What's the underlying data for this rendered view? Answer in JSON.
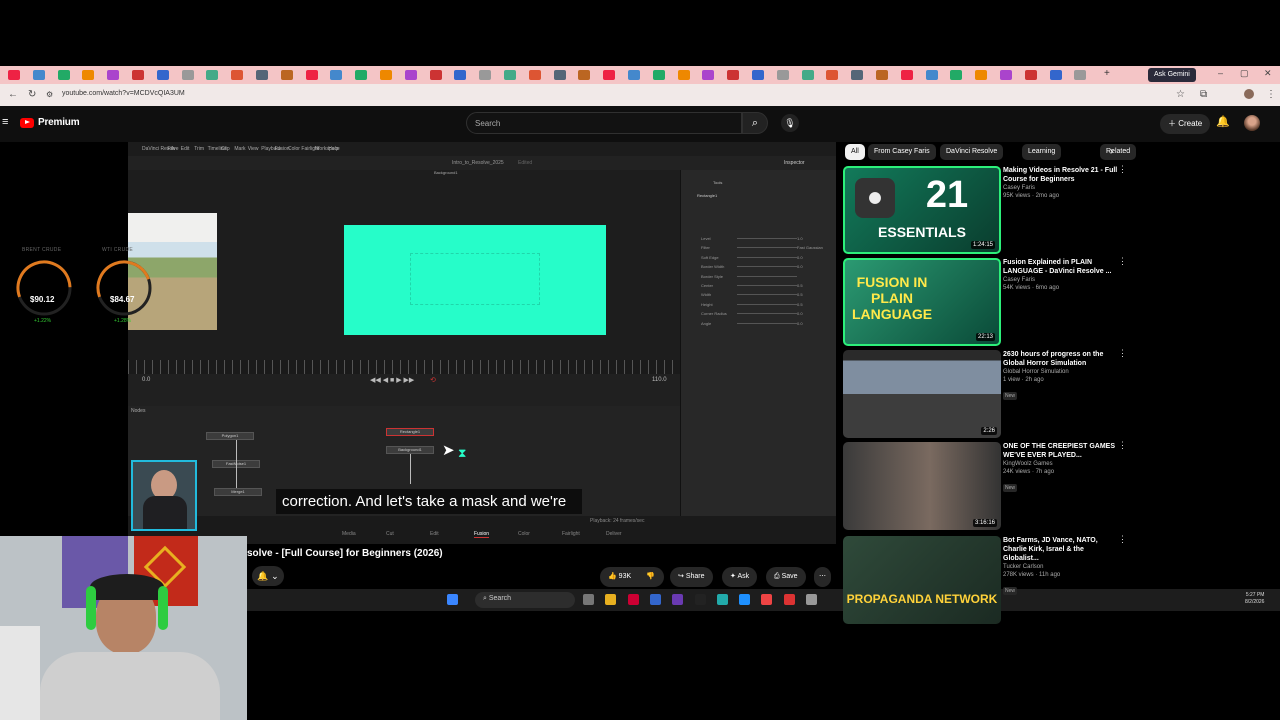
{
  "browser": {
    "url": "youtube.com/watch?v=MCDVcQIA3UM",
    "ask_gemini": "Ask Gemini",
    "tab_count_label": "+"
  },
  "youtube": {
    "brand": "Premium",
    "search_placeholder": "Search",
    "create_label": "Create"
  },
  "video": {
    "caption": "correction. And let's take a mask and we're",
    "title": "solve - [Full Course] for Beginners (2026)",
    "likes": "93K",
    "share_label": "Share",
    "ask_label": "Ask",
    "save_label": "Save",
    "resolve": {
      "menu": [
        "DaVinci Resolve",
        "File",
        "Edit",
        "Trim",
        "Timeline",
        "Clip",
        "Mark",
        "View",
        "Playback",
        "Fusion",
        "Color",
        "Fairlight",
        "Workspace",
        "Help"
      ],
      "project_name": "Intro_to_Resolve_2025",
      "edited": "Edited",
      "viewer_label": "Background1",
      "frame_start": "0.0",
      "frame_end": "110.0",
      "nodes_label": "Nodes",
      "inspector_label": "Inspector",
      "tools_label": "Tools",
      "node_rect": "Rectangle1",
      "nodes": [
        "Polygon1",
        "FastNoise1",
        "Merge1",
        "Rectangle1",
        "Background1"
      ],
      "inspector_rows": [
        "Level",
        "Filter",
        "Soft Edge",
        "Border Width",
        "Border Style",
        "Center",
        "Width",
        "Height",
        "Corner Radius",
        "Angle"
      ],
      "inspector_values": [
        "1.0",
        "Fast Gaussian",
        "0.0",
        "0.0",
        "",
        "0.5",
        "0.5",
        "0.5",
        "0.0",
        "0.0"
      ],
      "pages": [
        "Media",
        "Cut",
        "Edit",
        "Fusion",
        "Color",
        "Fairlight",
        "Deliver"
      ],
      "active_page": "Fusion",
      "playback": "Playback: 24 frames/sec"
    }
  },
  "widgets": {
    "gauges": [
      {
        "label": "BRENT CRUDE",
        "value": "$90.12",
        "change": "+1.22%",
        "level": 0.55
      },
      {
        "label": "WTI CRUDE",
        "value": "$84.67",
        "change": "+1.28%",
        "level": 0.5
      }
    ]
  },
  "sidebar": {
    "chips": [
      "All",
      "From Casey Faris",
      "DaVinci Resolve",
      "Learning",
      "Related"
    ],
    "videos": [
      {
        "title": "Making Videos in Resolve 21 - Full Course for Beginners",
        "channel": "Casey Faris",
        "meta": "95K views · 2mo ago",
        "duration": "1:24:15",
        "thumb_text": "21",
        "thumb_sub": "ESSENTIALS",
        "badge": ""
      },
      {
        "title": "Fusion Explained in PLAIN LANGUAGE - DaVinci Resolve ...",
        "channel": "Casey Faris",
        "meta": "54K views · 6mo ago",
        "duration": "22:13",
        "thumb_text": "FUSION IN PLAIN LANGUAGE",
        "thumb_sub": "",
        "badge": ""
      },
      {
        "title": "2630 hours of progress on the Global Horror Simulation",
        "channel": "Global Horror Simulation",
        "meta": "1 view · 2h ago",
        "duration": "2:26",
        "thumb_text": "",
        "thumb_sub": "",
        "badge": "New"
      },
      {
        "title": "ONE OF THE CREEPIEST GAMES WE'VE EVER PLAYED...",
        "channel": "KingWoolz Games",
        "meta": "24K views · 7h ago",
        "duration": "3:16:16",
        "thumb_text": "",
        "thumb_sub": "",
        "badge": "New"
      },
      {
        "title": "Bot Farms, JD Vance, NATO, Charlie Kirk, Israel & the Globalist...",
        "channel": "Tucker Carlson",
        "meta": "278K views · 11h ago",
        "duration": "",
        "thumb_text": "PROPAGANDA NETWORK",
        "thumb_sub": "",
        "badge": "New"
      }
    ]
  },
  "taskbar": {
    "search": "Search",
    "time": "5:27 PM",
    "date": "8/2/2026"
  },
  "colors": {
    "accent_green": "#26fdc9",
    "yt_red": "#ff0000",
    "tabbar": "#f4c5c6",
    "gauge_orange": "#e07a1f"
  }
}
